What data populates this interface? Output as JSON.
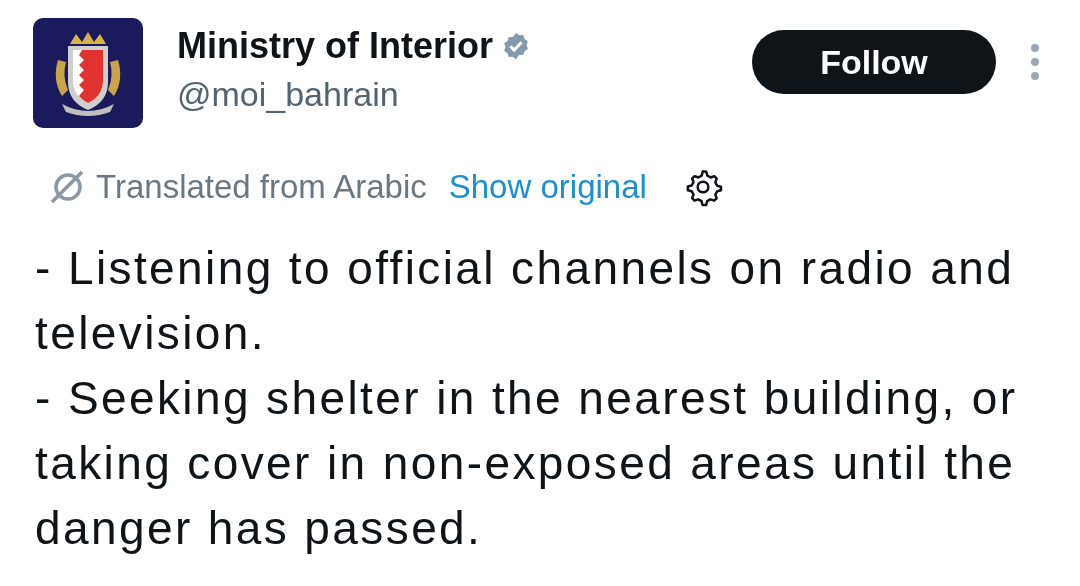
{
  "author": {
    "name": "Ministry of Interior",
    "verified": true,
    "handle": "@moi_bahrain"
  },
  "follow_button": "Follow",
  "translation": {
    "label": "Translated from Arabic",
    "link": "Show original"
  },
  "body": [
    "- Listening to official channels on radio and television.",
    "- Seeking shelter in the nearest building, or taking cover in non-exposed areas until the danger has passed."
  ]
}
